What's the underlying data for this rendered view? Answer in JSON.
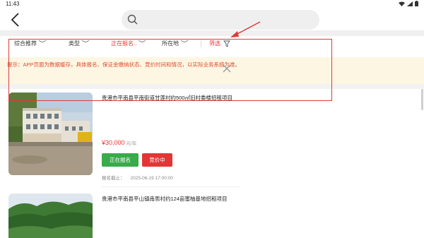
{
  "status_bar": {
    "time": "11:43"
  },
  "search": {
    "placeholder": ""
  },
  "filters": [
    {
      "label": "综合推荐",
      "active": false
    },
    {
      "label": "类型",
      "active": false
    },
    {
      "label": "正在报名..",
      "active": true
    },
    {
      "label": "所在地",
      "active": false
    }
  ],
  "screen": {
    "label": "筛选"
  },
  "notice": {
    "text": "提示：APP页面为数据缓存，具体报名、保证金缴纳状态、竞价时间和情况，以实际业务系统为准。"
  },
  "listings": [
    {
      "title": "贵港市平南县平南街道甘莲村约500㎡旧村委楼招租项目",
      "price": "¥30,000",
      "price_unit": "元/年",
      "status_enroll": "正在报名",
      "status_bidding": "竞价中",
      "deadline_label": "报名截止：",
      "deadline_value": "2025-06-19 17:00:00"
    },
    {
      "title": "贵港市平南县平山镇南思村约124亩蜜柚基地招租项目"
    }
  ],
  "colors": {
    "accent": "#e33333",
    "enroll_green": "#3aaa4a",
    "notice_bg": "#fdf6e3"
  }
}
